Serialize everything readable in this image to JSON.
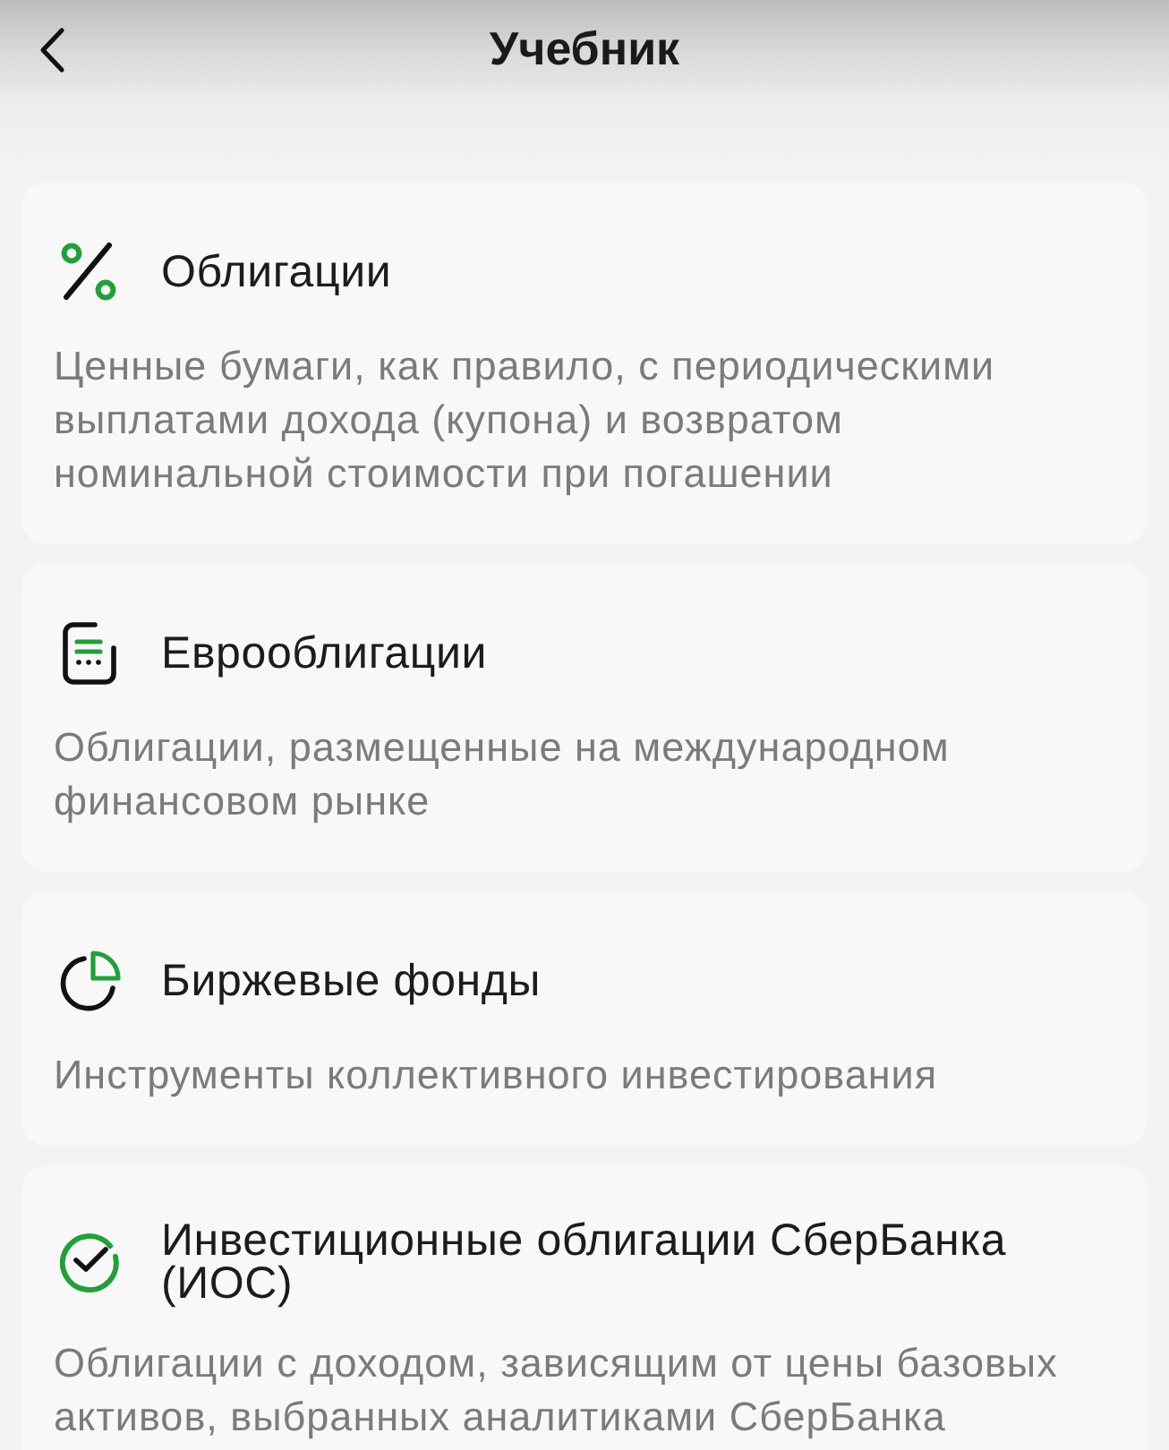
{
  "header": {
    "title": "Учебник"
  },
  "topics": [
    {
      "kind": "percent",
      "title": "Облигации",
      "description": "Ценные бумаги, как правило, с периодическими выплатами дохода (купона) и возвратом номинальной стоимости при погашении"
    },
    {
      "kind": "document",
      "title": "Еврооблигации",
      "description": "Облигации, размещенные на международном финансовом рынке"
    },
    {
      "kind": "pie",
      "title": "Биржевые фонды",
      "description": "Инструменты коллективного инвестирования"
    },
    {
      "kind": "check",
      "title": "Инвестиционные облигации СберБанка (ИОС)",
      "description": "Облигации с доходом, зависящим от цены базовых активов, выбранных аналитиками СберБанка"
    }
  ]
}
